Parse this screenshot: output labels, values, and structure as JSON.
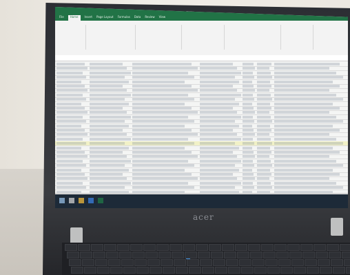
{
  "photo": {
    "description_tags": [
      "laptop",
      "spreadsheet",
      "desk"
    ]
  },
  "laptop": {
    "brand": "acer"
  },
  "spreadsheet": {
    "app": "Excel",
    "title_bar": "Office",
    "active_tab": "Home",
    "tabs": [
      "File",
      "Home",
      "Insert",
      "Page Layout",
      "Formulas",
      "Data",
      "Review",
      "View"
    ],
    "row_count_visible": 30,
    "highlighted_row_index": 18
  },
  "colors": {
    "excel_green": "#217346",
    "highlight_row": "#f1f1c7",
    "taskbar": "#1d2a38"
  }
}
